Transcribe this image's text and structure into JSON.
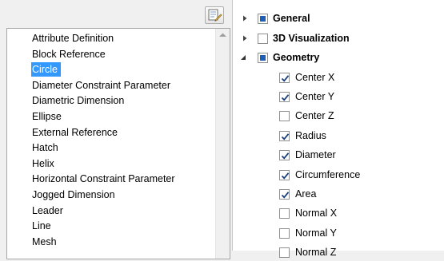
{
  "entity_list": {
    "items": [
      {
        "label": "Attribute Definition",
        "selected": false
      },
      {
        "label": "Block Reference",
        "selected": false
      },
      {
        "label": "Circle",
        "selected": true
      },
      {
        "label": "Diameter Constraint Parameter",
        "selected": false
      },
      {
        "label": "Diametric Dimension",
        "selected": false
      },
      {
        "label": "Ellipse",
        "selected": false
      },
      {
        "label": "External Reference",
        "selected": false
      },
      {
        "label": "Hatch",
        "selected": false
      },
      {
        "label": "Helix",
        "selected": false
      },
      {
        "label": "Horizontal Constraint Parameter",
        "selected": false
      },
      {
        "label": "Jogged Dimension",
        "selected": false
      },
      {
        "label": "Leader",
        "selected": false
      },
      {
        "label": "Line",
        "selected": false
      },
      {
        "label": "Mesh",
        "selected": false
      }
    ]
  },
  "property_tree": {
    "categories": [
      {
        "label": "General",
        "expanded": false,
        "state": "partial"
      },
      {
        "label": "3D Visualization",
        "expanded": false,
        "state": "unchecked"
      },
      {
        "label": "Geometry",
        "expanded": true,
        "state": "partial",
        "children": [
          {
            "label": "Center X",
            "checked": true
          },
          {
            "label": "Center Y",
            "checked": true
          },
          {
            "label": "Center Z",
            "checked": false
          },
          {
            "label": "Radius",
            "checked": true
          },
          {
            "label": "Diameter",
            "checked": true
          },
          {
            "label": "Circumference",
            "checked": true
          },
          {
            "label": "Area",
            "checked": true
          },
          {
            "label": "Normal X",
            "checked": false
          },
          {
            "label": "Normal Y",
            "checked": false
          },
          {
            "label": "Normal Z",
            "checked": false
          }
        ]
      }
    ]
  },
  "icons": {
    "edit_button": "edit-list-icon",
    "scroll_up": "scroll-up-arrow-icon",
    "collapsed": "triangle-right-icon",
    "expanded": "triangle-down-icon",
    "check": "check-mark-icon"
  },
  "colors": {
    "selection": "#3399ff",
    "partial_fill": "#1c5fb5",
    "check": "#1a3f7a"
  }
}
